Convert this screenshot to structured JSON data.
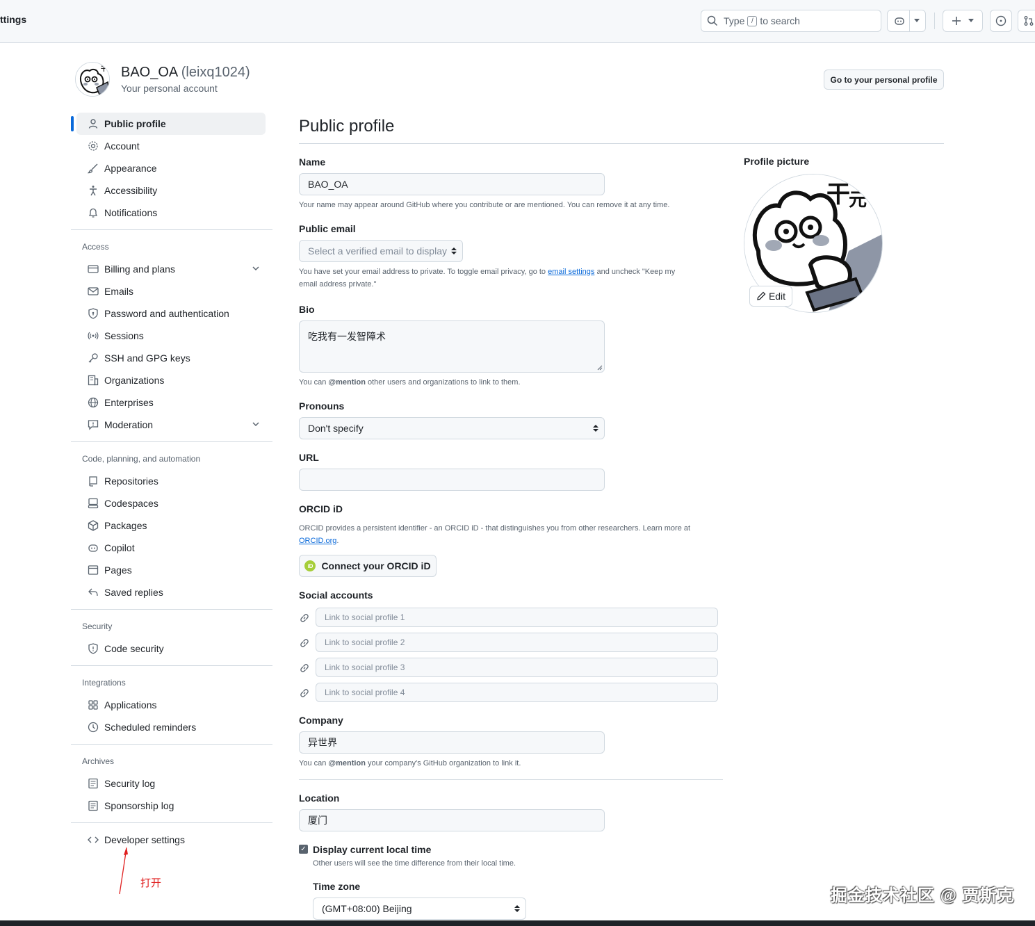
{
  "header": {
    "crumb": "ttings",
    "search_prefix": "Type",
    "search_key": "/",
    "search_suffix": "to search"
  },
  "account": {
    "display_name": "BAO_OA",
    "login": "(leixq1024)",
    "subtitle": "Your personal account",
    "go_profile": "Go to your personal profile"
  },
  "sidebar": {
    "top": [
      {
        "label": "Public profile",
        "icon": "person-icon"
      },
      {
        "label": "Account",
        "icon": "gear-icon"
      },
      {
        "label": "Appearance",
        "icon": "paintbrush-icon"
      },
      {
        "label": "Accessibility",
        "icon": "accessibility-icon"
      },
      {
        "label": "Notifications",
        "icon": "bell-icon"
      }
    ],
    "access_title": "Access",
    "access": [
      {
        "label": "Billing and plans",
        "icon": "credit-card-icon"
      },
      {
        "label": "Emails",
        "icon": "mail-icon"
      },
      {
        "label": "Password and authentication",
        "icon": "shield-lock-icon"
      },
      {
        "label": "Sessions",
        "icon": "broadcast-icon"
      },
      {
        "label": "SSH and GPG keys",
        "icon": "key-icon"
      },
      {
        "label": "Organizations",
        "icon": "organization-icon"
      },
      {
        "label": "Enterprises",
        "icon": "globe-icon"
      },
      {
        "label": "Moderation",
        "icon": "report-icon"
      }
    ],
    "code_title": "Code, planning, and automation",
    "code": [
      {
        "label": "Repositories",
        "icon": "repo-icon"
      },
      {
        "label": "Codespaces",
        "icon": "codespaces-icon"
      },
      {
        "label": "Packages",
        "icon": "package-icon"
      },
      {
        "label": "Copilot",
        "icon": "copilot-icon"
      },
      {
        "label": "Pages",
        "icon": "browser-icon"
      },
      {
        "label": "Saved replies",
        "icon": "reply-icon"
      }
    ],
    "security_title": "Security",
    "security": [
      {
        "label": "Code security",
        "icon": "shield-icon"
      }
    ],
    "integrations_title": "Integrations",
    "integrations": [
      {
        "label": "Applications",
        "icon": "apps-icon"
      },
      {
        "label": "Scheduled reminders",
        "icon": "clock-icon"
      }
    ],
    "archives_title": "Archives",
    "archives": [
      {
        "label": "Security log",
        "icon": "log-icon"
      },
      {
        "label": "Sponsorship log",
        "icon": "log-icon"
      }
    ],
    "developer": {
      "label": "Developer settings",
      "icon": "code-icon"
    }
  },
  "main": {
    "title": "Public profile",
    "name_label": "Name",
    "name_value": "BAO_OA",
    "name_note": "Your name may appear around GitHub where you contribute or are mentioned. You can remove it at any time.",
    "email_label": "Public email",
    "email_select": "Select a verified email to display",
    "email_note_1": "You have set your email address to private. To toggle email privacy, go to",
    "email_note_link": "email settings",
    "email_note_2": "and uncheck \"Keep my",
    "email_note_3": "email address private.\"",
    "bio_label": "Bio",
    "bio_value": "吃我有一发智障术",
    "bio_note_1": "You can",
    "bio_note_mention": "@mention",
    "bio_note_2": "other users and organizations to link to them.",
    "pronouns_label": "Pronouns",
    "pronouns_value": "Don't specify",
    "url_label": "URL",
    "url_value": "",
    "orcid_label": "ORCID iD",
    "orcid_note": "ORCID provides a persistent identifier - an ORCID iD - that distinguishes you from other researchers. Learn more at",
    "orcid_link": "ORCID.org",
    "orcid_button": "Connect your ORCID iD",
    "orcid_badge": "iD",
    "social_label": "Social accounts",
    "social": [
      "Link to social profile 1",
      "Link to social profile 2",
      "Link to social profile 3",
      "Link to social profile 4"
    ],
    "company_label": "Company",
    "company_value": "异世界",
    "company_note_1": "You can",
    "company_note_mention": "@mention",
    "company_note_2": "your company's GitHub organization to link it.",
    "location_label": "Location",
    "location_value": "厦门",
    "localtime_label": "Display current local time",
    "localtime_checked": true,
    "localtime_note": "Other users will see the time difference from their local time.",
    "timezone_label": "Time zone",
    "timezone_value": "(GMT+08:00) Beijing",
    "picture_label": "Profile picture",
    "picture_edit": "Edit"
  },
  "annotation": {
    "text": "打开",
    "color": "#e02020"
  },
  "watermark": "掘金技术社区 @ 贾斯克",
  "colors": {
    "accent": "#0969da",
    "border": "#d1d9e0",
    "muted": "#59636e",
    "field_bg": "#f6f8fa",
    "orcid_green": "#a6ce39"
  }
}
